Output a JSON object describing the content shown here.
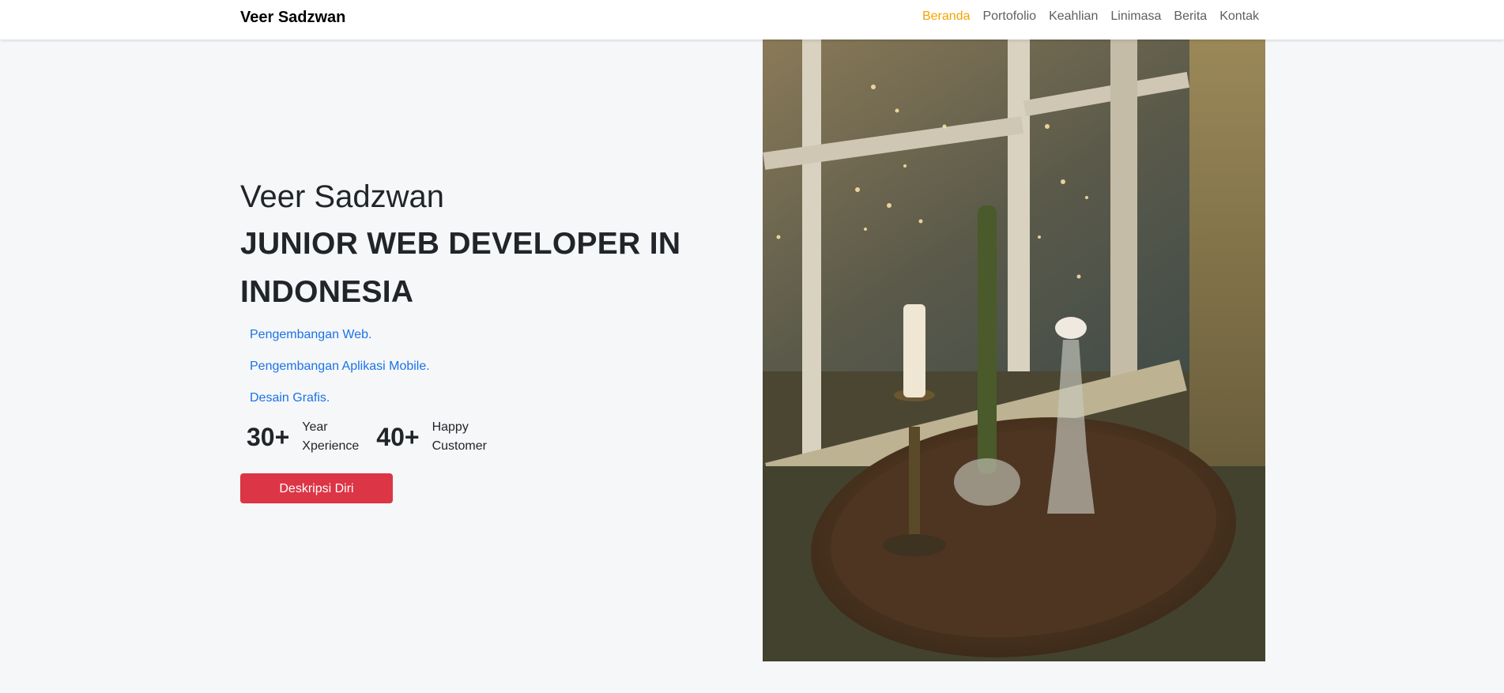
{
  "navbar": {
    "brand": "Veer Sadzwan",
    "links": [
      "Beranda",
      "Portofolio",
      "Keahlian",
      "Linimasa",
      "Berita",
      "Kontak"
    ],
    "active_link": "Beranda"
  },
  "hero": {
    "name": "Veer Sadzwan",
    "title_line1": "JUNIOR WEB DEVELOPER IN",
    "title_line2": "INDONESIA",
    "services": [
      "Pengembangan Web.",
      "Pengembangan Aplikasi Mobile.",
      "Desain Grafis."
    ],
    "stats": [
      {
        "number": "30+",
        "label_line1": "Year",
        "label_line2": "Xperience"
      },
      {
        "number": "40+",
        "label_line1": "Happy",
        "label_line2": "Customer"
      }
    ],
    "button_label": "Deskripsi Diri"
  },
  "colors": {
    "active_nav": "#f5a300",
    "service_link": "#1a73e8",
    "button": "#dc3545",
    "background": "#f6f7f9"
  }
}
